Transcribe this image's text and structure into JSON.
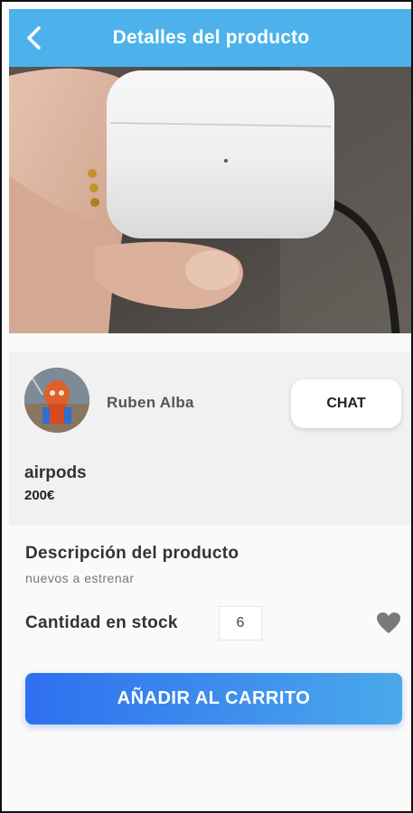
{
  "app_bar": {
    "title": "Detalles del producto",
    "back_icon": "chevron-left-icon",
    "color": "#4db2ec"
  },
  "seller": {
    "name": "Ruben Alba",
    "chat_label": "CHAT"
  },
  "product": {
    "name": "airpods",
    "price": "200€"
  },
  "details": {
    "description_title": "Descripción del producto",
    "description_text": "nuevos a estrenar",
    "stock_label": "Cantidad en stock",
    "stock_value": "6",
    "favorite_icon": "heart-icon"
  },
  "add_to_cart": {
    "label": "AÑADIR AL CARRITO",
    "gradient_start": "#2f6ff0",
    "gradient_end": "#4aa9ea"
  }
}
